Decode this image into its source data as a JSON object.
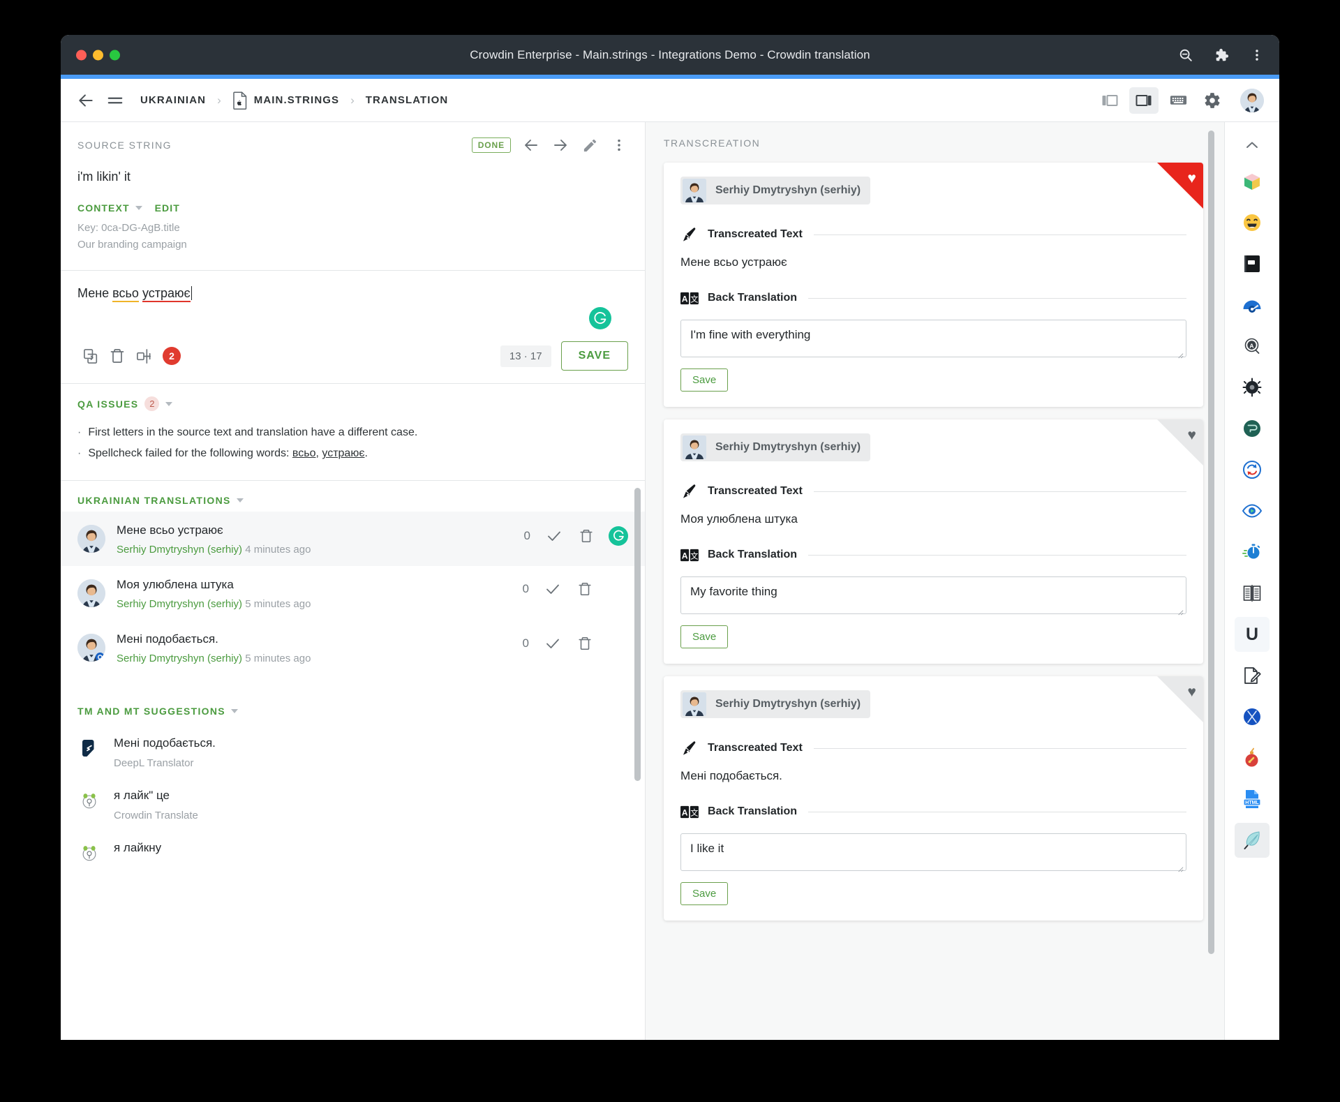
{
  "window": {
    "title": "Crowdin Enterprise - Main.strings - Integrations Demo - Crowdin translation",
    "titlebar_icons": [
      "zoom-out-icon",
      "extensions-puzzle-icon",
      "browser-menu-icon"
    ]
  },
  "toolbar": {
    "back_icon": "back-arrow-icon",
    "menu_icon": "hamburger-menu-icon",
    "breadcrumb": {
      "language": "UKRAINIAN",
      "file": "MAIN.STRINGS",
      "section": "TRANSLATION",
      "separator": "›",
      "file_icon": "apple-file-icon"
    },
    "right_buttons": [
      {
        "name": "layout-two-pane-icon",
        "active": false
      },
      {
        "name": "layout-three-pane-icon",
        "active": true
      },
      {
        "name": "keyboard-shortcuts-icon",
        "active": false
      },
      {
        "name": "settings-gear-icon",
        "active": false
      }
    ],
    "avatar": "user-avatar"
  },
  "source": {
    "section_label": "SOURCE STRING",
    "status_badge": "DONE",
    "prev_icon": "previous-string-icon",
    "next_icon": "next-string-icon",
    "edit_icon": "edit-pencil-icon",
    "more_icon": "more-vertical-icon",
    "text": "i'm likin' it",
    "context_label": "CONTEXT",
    "edit_label": "EDIT",
    "key_line": "Key: 0ca-DG-AgB.title",
    "context_line": "Our branding campaign"
  },
  "editor": {
    "text_plain": "Мене всьо устраює",
    "text_parts": [
      {
        "t": "Мене ",
        "mark": "none"
      },
      {
        "t": "всьо",
        "mark": "warning"
      },
      {
        "t": " ",
        "mark": "none"
      },
      {
        "t": "устраює",
        "mark": "error"
      }
    ],
    "grammarly_icon": "grammarly-icon",
    "tools": [
      {
        "name": "copy-source-icon"
      },
      {
        "name": "clear-translation-icon"
      },
      {
        "name": "compare-icon"
      }
    ],
    "issues_badge": "2",
    "counter": "13 · 17",
    "save_label": "SAVE"
  },
  "qa": {
    "title": "QA ISSUES",
    "count": "2",
    "issues": [
      {
        "bullet": "·",
        "text": "First letters in the source text and translation have a different case."
      },
      {
        "bullet": "·",
        "prefix": "Spellcheck failed for the following words: ",
        "words": [
          "всьо",
          "устраює"
        ],
        "suffix": "."
      }
    ]
  },
  "translations": {
    "title": "UKRAINIAN TRANSLATIONS",
    "items": [
      {
        "text": "Мене всьо устраює",
        "author": "Serhiy Dmytryshyn (serhiy)",
        "time": "4 minutes ago",
        "votes": "0",
        "selected": true,
        "has_grammarly": true
      },
      {
        "text": "Моя улюблена штука",
        "author": "Serhiy Dmytryshyn (serhiy)",
        "time": "5 minutes ago",
        "votes": "0",
        "selected": false,
        "has_grammarly": false
      },
      {
        "text": "Мені подобається.",
        "author": "Serhiy Dmytryshyn (serhiy)",
        "time": "5 minutes ago",
        "votes": "0",
        "selected": false,
        "has_grammarly": false
      }
    ],
    "approve_icon": "approve-check-icon",
    "delete_icon": "delete-trash-icon"
  },
  "suggestions": {
    "title": "TM AND MT SUGGESTIONS",
    "items": [
      {
        "text": "Мені подобається.",
        "source": "DeepL Translator",
        "icon": "deepl-logo-icon"
      },
      {
        "text": "я лайк\" це",
        "source": "Crowdin Translate",
        "icon": "crowdin-logo-icon"
      },
      {
        "text": "я лайкну",
        "source": "",
        "icon": "crowdin-logo-icon"
      }
    ]
  },
  "transcreation": {
    "section_label": "TRANSCREATION",
    "field_labels": {
      "transcreated": "Transcreated Text",
      "back_translation": "Back Translation"
    },
    "icons": {
      "transcreated": "fountain-pen-icon",
      "back_translation": "translate-ab-icon",
      "favorite": "heart-icon"
    },
    "save_label": "Save",
    "cards": [
      {
        "author": "Serhiy Dmytryshyn (serhiy)",
        "transcreated_text": "Мене всьо устраює",
        "back_translation": "I'm fine with everything",
        "favorited": true
      },
      {
        "author": "Serhiy Dmytryshyn (serhiy)",
        "transcreated_text": "Моя улюблена штука",
        "back_translation": "My favorite thing",
        "favorited": false
      },
      {
        "author": "Serhiy Dmytryshyn (serhiy)",
        "transcreated_text": "Мені подобається.",
        "back_translation": "I like it",
        "favorited": false
      }
    ]
  },
  "rail": {
    "collapse_icon": "chevron-up-icon",
    "items": [
      {
        "name": "glossary-box-icon",
        "glyph": "📦",
        "active": false
      },
      {
        "name": "emoji-smile-icon",
        "glyph": "😄",
        "active": false
      },
      {
        "name": "dictionary-book-icon",
        "glyph": "📘",
        "active": false
      },
      {
        "name": "speedometer-icon",
        "glyph": "🌀",
        "active": false
      },
      {
        "name": "search-letter-icon",
        "glyph": "🔍",
        "active": false
      },
      {
        "name": "virus-gear-icon",
        "glyph": "⚙",
        "active": false
      },
      {
        "name": "tag-label-icon",
        "glyph": "🏷",
        "active": false
      },
      {
        "name": "sync-refresh-icon",
        "glyph": "🔄",
        "active": false
      },
      {
        "name": "preview-eye-icon",
        "glyph": "👁",
        "active": false
      },
      {
        "name": "stopwatch-icon",
        "glyph": "⏱",
        "active": false
      },
      {
        "name": "compare-columns-icon",
        "glyph": "📑",
        "active": false
      },
      {
        "name": "underline-u-icon",
        "glyph": "U",
        "active": false
      },
      {
        "name": "edit-note-icon",
        "glyph": "📝",
        "active": false
      },
      {
        "name": "x-circle-icon",
        "glyph": "✕",
        "active": false
      },
      {
        "name": "bomb-icon",
        "glyph": "💣",
        "active": false
      },
      {
        "name": "html-file-icon",
        "glyph": "HTML",
        "active": false
      },
      {
        "name": "feather-quill-icon",
        "glyph": "🪶",
        "active": true
      }
    ]
  },
  "colors": {
    "accent_blue": "#4a9bf5",
    "brand_green": "#4b9b3f",
    "favorite_red": "#e8251c",
    "error_red": "#e03b2f",
    "warning_yellow": "#f0b429",
    "grammarly_green": "#15c39a",
    "titlebar": "#2b3239"
  }
}
